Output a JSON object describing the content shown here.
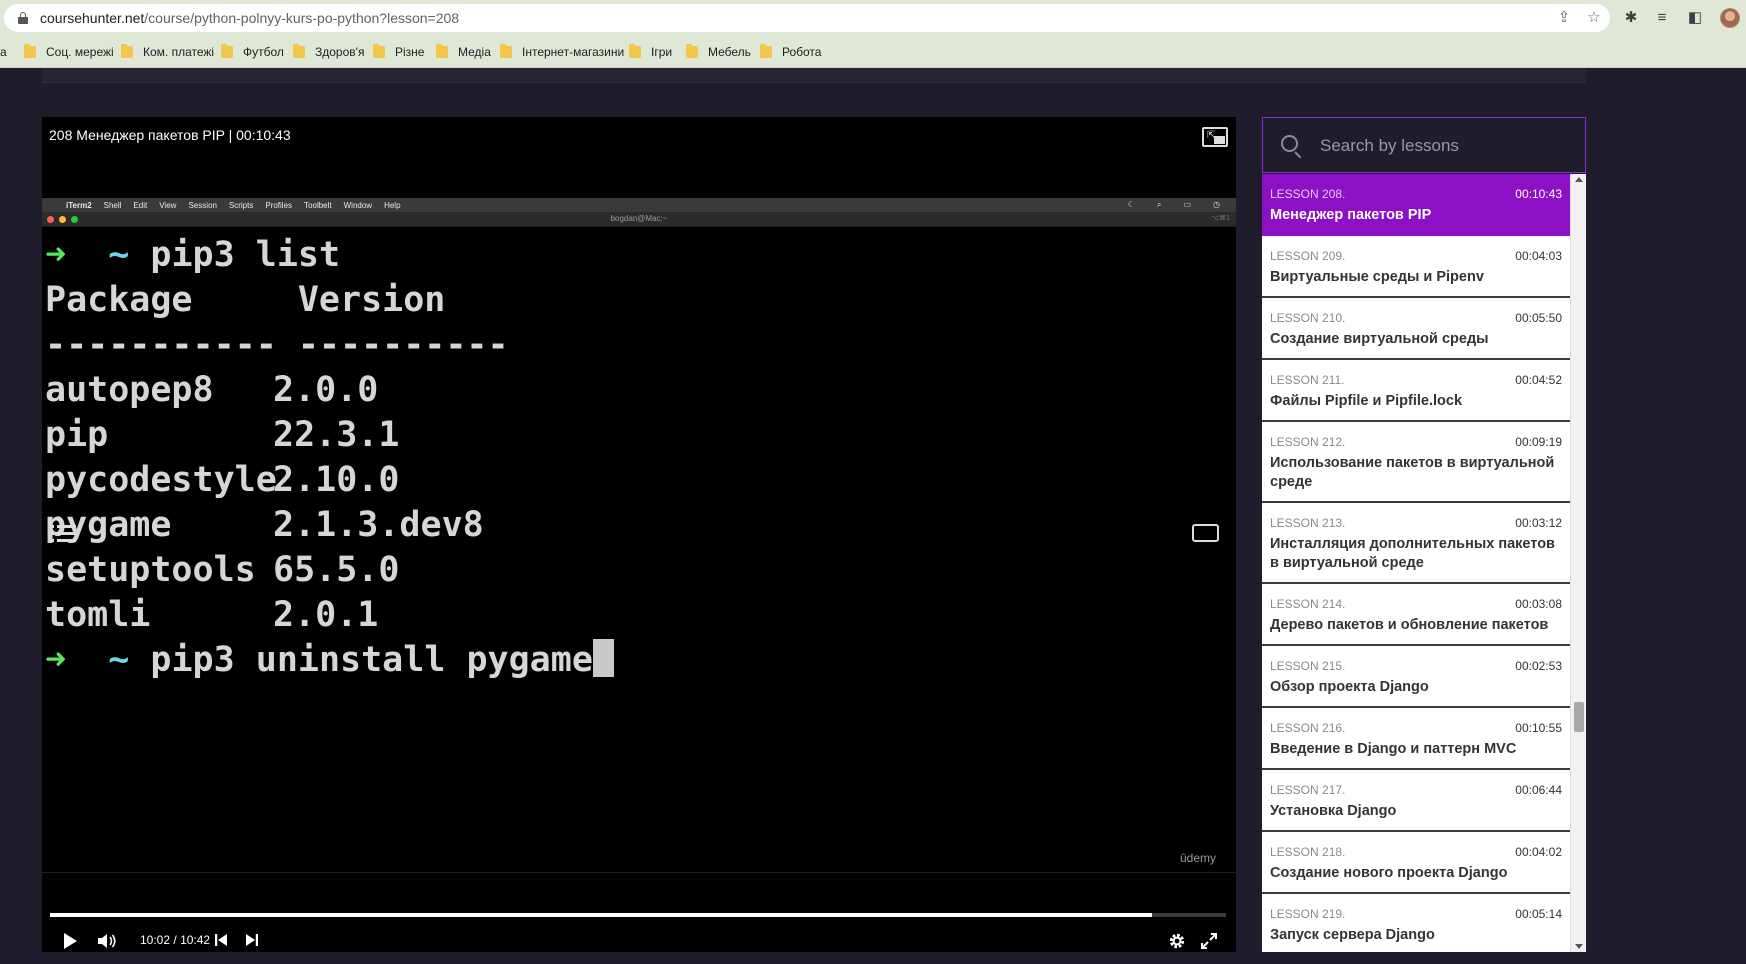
{
  "browser": {
    "url_domain": "coursehunter.net",
    "url_path": "/course/python-polnyy-kurs-po-python?lesson=208",
    "bookmarks": [
      {
        "label": "а",
        "folder": false
      },
      {
        "label": "Соц. мережі",
        "folder": true
      },
      {
        "label": "Ком. платежі",
        "folder": true
      },
      {
        "label": "Футбол",
        "folder": true
      },
      {
        "label": "Здоров'я",
        "folder": true
      },
      {
        "label": "Різне",
        "folder": true
      },
      {
        "label": "Медіа",
        "folder": true
      },
      {
        "label": "Інтернет-магазини",
        "folder": true
      },
      {
        "label": "Ігри",
        "folder": true
      },
      {
        "label": "Мебель",
        "folder": true
      },
      {
        "label": "Робота",
        "folder": true
      }
    ]
  },
  "player": {
    "title": "208 Менеджер пакетов PIP | 00:10:43",
    "time_current": "10:02",
    "time_separator": "/",
    "time_total": "10:42",
    "progress_fraction": 0.937,
    "watermark": "ûdemy",
    "video": {
      "mac_menu": [
        "iTerm2",
        "Shell",
        "Edit",
        "View",
        "Session",
        "Scripts",
        "Profiles",
        "Toolbelt",
        "Window",
        "Help"
      ],
      "terminal_title": "bogdan@Mac:~",
      "terminal_shortcut": "⌥⌘1",
      "prompt_arrow": "➜",
      "prompt_tilde": "~",
      "command1": "pip3 list",
      "header": "Package     Version",
      "divider": "----------- ----------",
      "packages": [
        {
          "name": "autopep8",
          "version": "2.0.0"
        },
        {
          "name": "pip",
          "version": "22.3.1"
        },
        {
          "name": "pycodestyle",
          "version": "2.10.0"
        },
        {
          "name": "pygame",
          "version": "2.1.3.dev8"
        },
        {
          "name": "setuptools",
          "version": "65.5.0"
        },
        {
          "name": "tomli",
          "version": "2.0.1"
        }
      ],
      "command2": "pip3 uninstall pygame"
    }
  },
  "sidebar": {
    "search_placeholder": "Search by lessons",
    "accent_color": "#8c10c4",
    "lessons": [
      {
        "num": "LESSON 208.",
        "duration": "00:10:43",
        "title": "Менеджер пакетов PIP",
        "active": true
      },
      {
        "num": "LESSON 209.",
        "duration": "00:04:03",
        "title": "Виртуальные среды и Pipenv"
      },
      {
        "num": "LESSON 210.",
        "duration": "00:05:50",
        "title": "Создание виртуальной среды"
      },
      {
        "num": "LESSON 211.",
        "duration": "00:04:52",
        "title": "Файлы Pipfile и Pipfile.lock"
      },
      {
        "num": "LESSON 212.",
        "duration": "00:09:19",
        "title": "Использование пакетов в виртуальной среде",
        "tall": true
      },
      {
        "num": "LESSON 213.",
        "duration": "00:03:12",
        "title": "Инсталляция дополнительных пакетов в виртуальной среде",
        "tall": true
      },
      {
        "num": "LESSON 214.",
        "duration": "00:03:08",
        "title": "Дерево пакетов и обновление пакетов"
      },
      {
        "num": "LESSON 215.",
        "duration": "00:02:53",
        "title": "Обзор проекта Django"
      },
      {
        "num": "LESSON 216.",
        "duration": "00:10:55",
        "title": "Введение в Django и паттерн MVC"
      },
      {
        "num": "LESSON 217.",
        "duration": "00:06:44",
        "title": "Установка Django"
      },
      {
        "num": "LESSON 218.",
        "duration": "00:04:02",
        "title": "Создание нового проекта Django"
      },
      {
        "num": "LESSON 219.",
        "duration": "00:05:14",
        "title": "Запуск сервера Django"
      }
    ]
  }
}
